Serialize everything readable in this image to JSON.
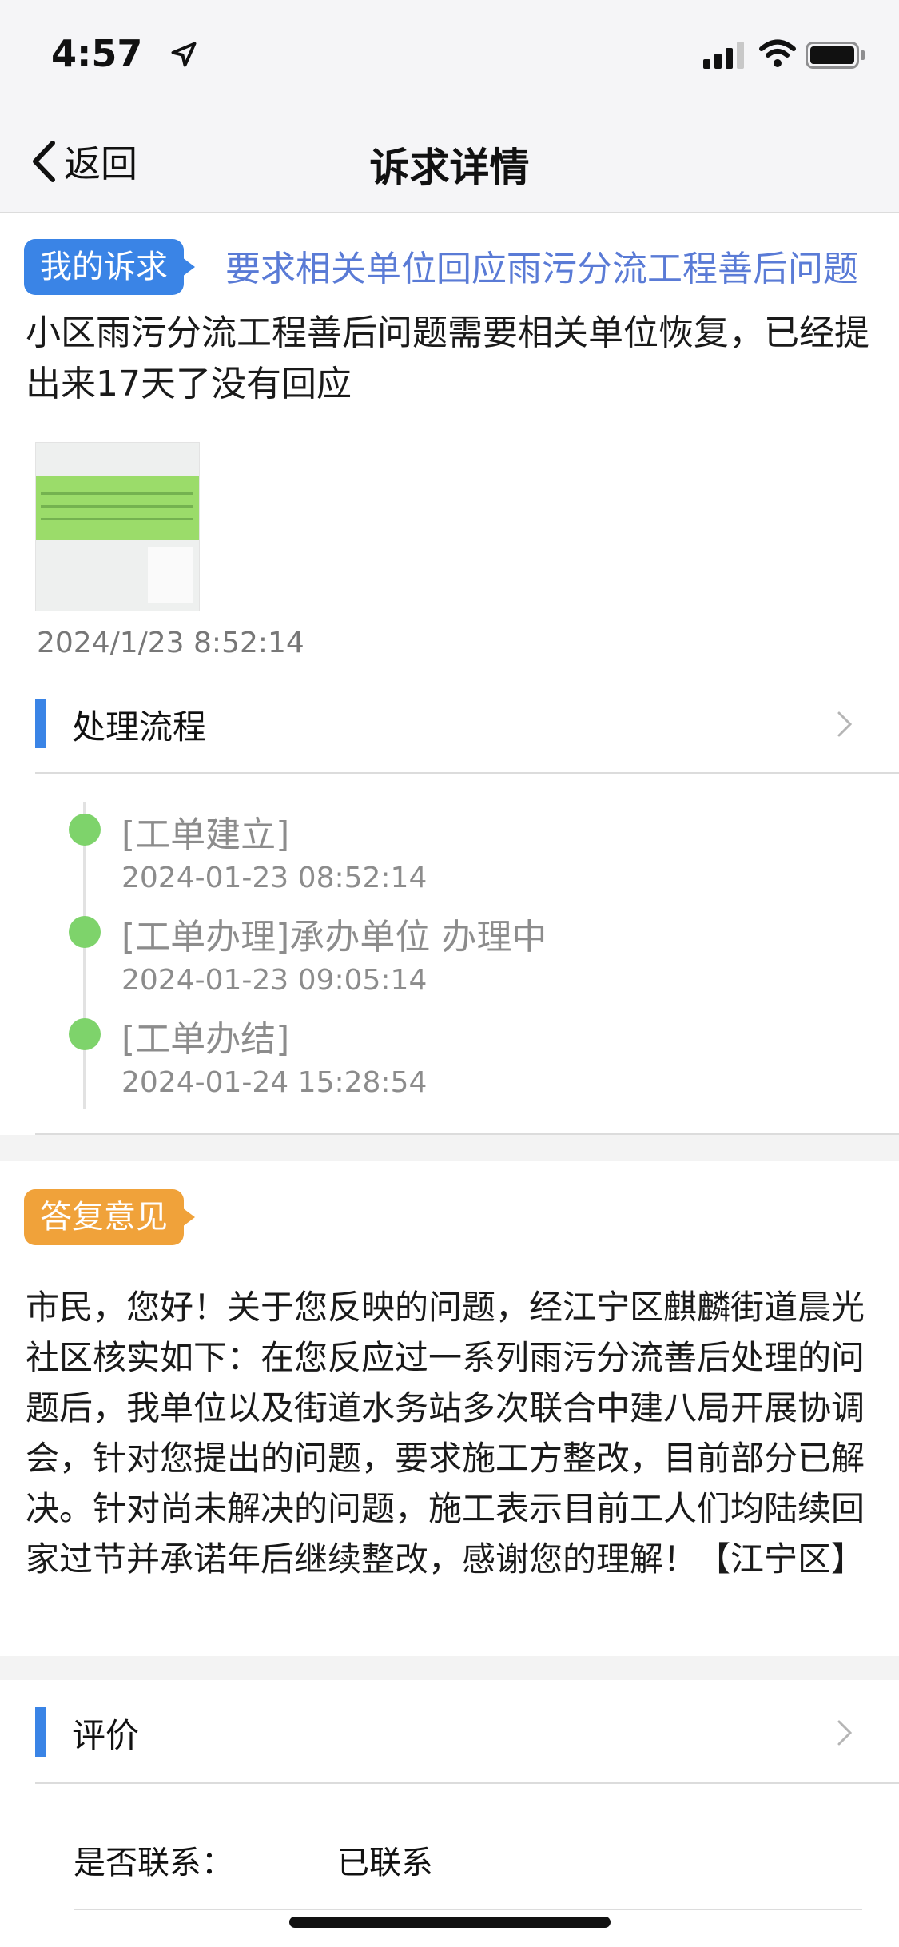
{
  "status_bar": {
    "time": "4:57"
  },
  "nav": {
    "back_label": "返回",
    "title": "诉求详情"
  },
  "complaint": {
    "tag": "我的诉求",
    "title": "要求相关单位回应雨污分流工程善后问题",
    "description": "小区雨污分流工程善后问题需要相关单位恢复，已经提出来17天了没有回应",
    "submitted_at": "2024/1/23 8:52:14"
  },
  "process": {
    "header": "处理流程",
    "steps": [
      {
        "title": "[工单建立]",
        "time": "2024-01-23 08:52:14"
      },
      {
        "title": "[工单办理]承办单位 办理中",
        "time": "2024-01-23 09:05:14"
      },
      {
        "title": "[工单办结]",
        "time": "2024-01-24 15:28:54"
      }
    ]
  },
  "reply": {
    "tag": "答复意见",
    "text": "市民，您好！关于您反映的问题，经江宁区麒麟街道晨光社区核实如下：在您反应过一系列雨污分流善后处理的问题后，我单位以及街道水务站多次联合中建八局开展协调会，针对您提出的问题，要求施工方整改，目前部分已解决。针对尚未解决的问题，施工表示目前工人们均陆续回家过节并承诺年后继续整改，感谢您的理解！【江宁区】"
  },
  "evaluation": {
    "header": "评价",
    "fields": [
      {
        "label": "是否联系：",
        "value": "已联系"
      }
    ]
  },
  "colors": {
    "accent_blue": "#3a84e6",
    "tag_orange": "#f0a23a",
    "timeline_green": "#7ed36b",
    "link_blue": "#5a7bd6"
  }
}
